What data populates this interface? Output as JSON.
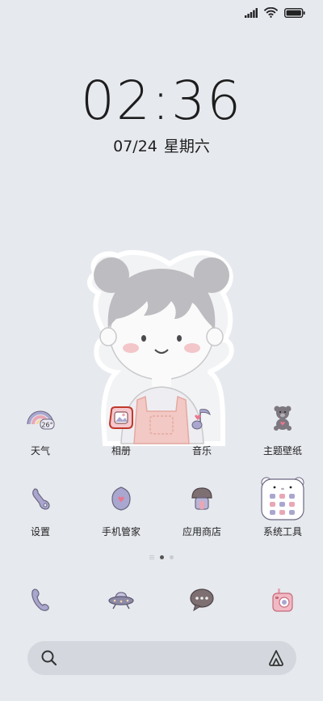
{
  "status_bar": {
    "signal_icon": "signal-icon",
    "wifi_icon": "wifi-icon",
    "battery_icon": "battery-icon"
  },
  "lockclock": {
    "time": "02:36",
    "date": "07/24",
    "weekday": "星期六"
  },
  "wallpaper": {
    "icon": "cartoon-girl-sticker"
  },
  "home_grid": {
    "row1": [
      {
        "label": "天气",
        "icon": "weather-rainbow-icon",
        "badge": "26°"
      },
      {
        "label": "相册",
        "icon": "gallery-icon"
      },
      {
        "label": "音乐",
        "icon": "music-note-icon"
      },
      {
        "label": "主题壁纸",
        "icon": "teddy-bear-icon"
      }
    ],
    "row2": [
      {
        "label": "设置",
        "icon": "wrench-icon"
      },
      {
        "label": "手机管家",
        "icon": "security-shield-icon"
      },
      {
        "label": "应用商店",
        "icon": "mushroom-store-icon"
      },
      {
        "label": "系统工具",
        "icon": "folder-icon"
      }
    ]
  },
  "dock": [
    {
      "name": "phone",
      "icon": "phone-icon"
    },
    {
      "name": "browser",
      "icon": "ufo-icon"
    },
    {
      "name": "messages",
      "icon": "chat-bubble-icon"
    },
    {
      "name": "camera",
      "icon": "camera-icon"
    }
  ],
  "search": {
    "icon": "search-icon",
    "assistant_icon": "ai-assistant-icon"
  },
  "colors": {
    "background": "#e6e9ee",
    "icon_purple": "#a9a7cf",
    "icon_pink": "#e9a7b5",
    "outline": "#6b6780"
  }
}
